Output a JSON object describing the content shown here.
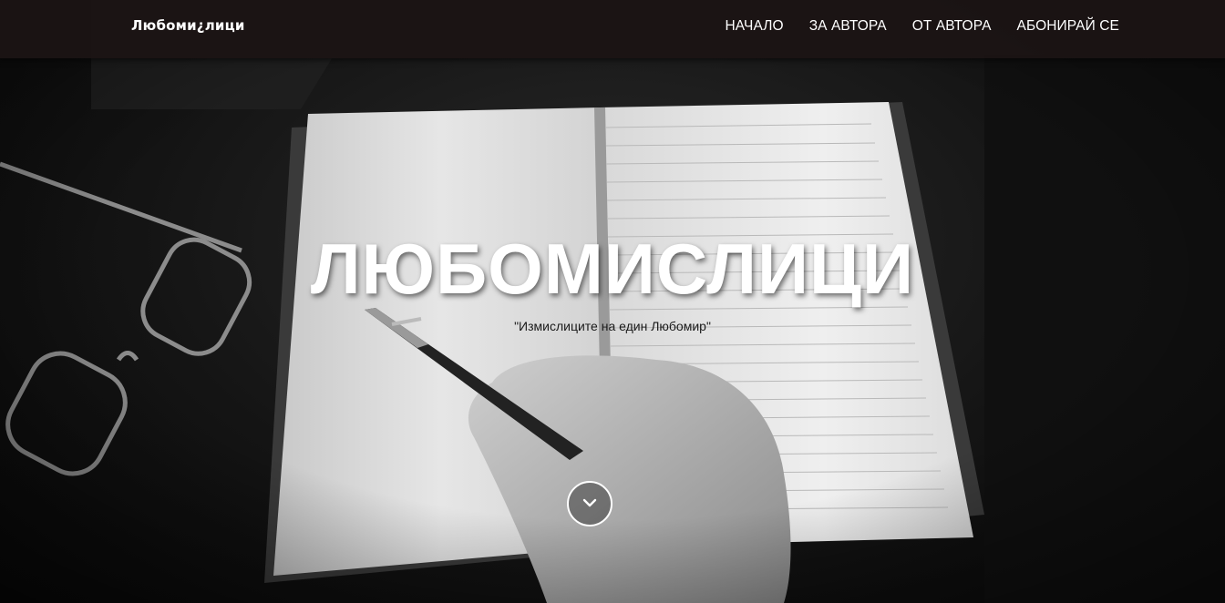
{
  "navbar": {
    "brand": "Любоми¿лици",
    "links": [
      "НАЧАЛО",
      "ЗА АВТОРА",
      "ОТ АВТОРА",
      "АБОНИРАЙ СЕ"
    ]
  },
  "hero": {
    "title": "ЛЮБОМИСЛИЦИ",
    "subtitle": "\"Измислиците на един Любомир\"",
    "scroll_icon": "chevron-down-icon"
  },
  "colors": {
    "navbar_bg": "#1c1414",
    "text_primary": "#ffffff",
    "subtitle_text": "#1a1a1a"
  }
}
